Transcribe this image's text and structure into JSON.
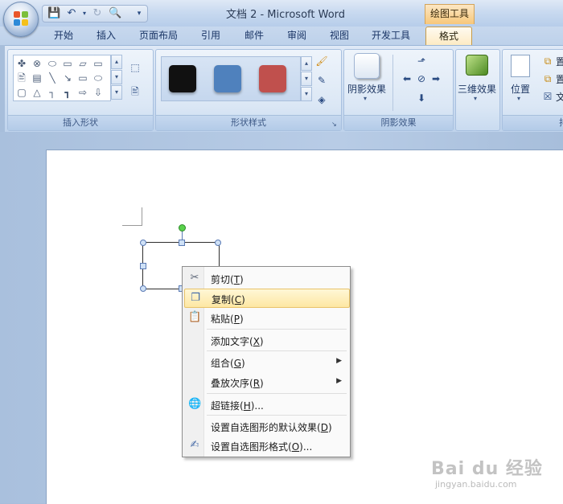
{
  "window": {
    "title": "文档 2 - Microsoft Word",
    "contextual_tab": "绘图工具"
  },
  "ribbon_tabs": [
    {
      "label": "开始"
    },
    {
      "label": "插入"
    },
    {
      "label": "页面布局"
    },
    {
      "label": "引用"
    },
    {
      "label": "邮件"
    },
    {
      "label": "审阅"
    },
    {
      "label": "视图"
    },
    {
      "label": "开发工具"
    },
    {
      "label": "格式",
      "active": true
    }
  ],
  "ribbon_groups": {
    "insert_shapes": "插入形状",
    "shape_styles": "形状样式",
    "shadow_effects": "阴影效果",
    "three_d_effects": "三维效果",
    "arrange": "排"
  },
  "ribbon_buttons": {
    "shadow_effects": "阴影效果",
    "three_d_effects": "三维效果",
    "position": "位置",
    "arrange_small_1": "置",
    "arrange_small_2": "置",
    "arrange_small_3": "文"
  },
  "shape_style_swatches": [
    "#111111",
    "#4f81bd",
    "#c0504d"
  ],
  "context_menu": {
    "items": [
      {
        "label": "剪切(T)",
        "pre": "剪切(",
        "key": "T",
        "post": ")",
        "icon": "scissors-icon"
      },
      {
        "label": "复制(C)",
        "pre": "复制(",
        "key": "C",
        "post": ")",
        "icon": "copy-icon",
        "highlighted": true
      },
      {
        "label": "粘贴(P)",
        "pre": "粘贴(",
        "key": "P",
        "post": ")",
        "icon": "paste-icon"
      },
      {
        "label": "添加文字(X)",
        "pre": "添加文字(",
        "key": "X",
        "post": ")"
      },
      {
        "label": "组合(G)",
        "pre": "组合(",
        "key": "G",
        "post": ")",
        "submenu": true
      },
      {
        "label": "叠放次序(R)",
        "pre": "叠放次序(",
        "key": "R",
        "post": ")",
        "submenu": true
      },
      {
        "label": "超链接(H)...",
        "pre": "超链接(",
        "key": "H",
        "post": ")...",
        "icon": "hyperlink-icon"
      },
      {
        "label": "设置自选图形的默认效果(D)",
        "pre": "设置自选图形的默认效果(",
        "key": "D",
        "post": ")"
      },
      {
        "label": "设置自选图形格式(O)...",
        "pre": "设置自选图形格式(",
        "key": "O",
        "post": ")...",
        "icon": "format-shape-icon"
      }
    ]
  },
  "watermark": {
    "brand": "Bai du 经验",
    "url": "jingyan.baidu.com"
  }
}
